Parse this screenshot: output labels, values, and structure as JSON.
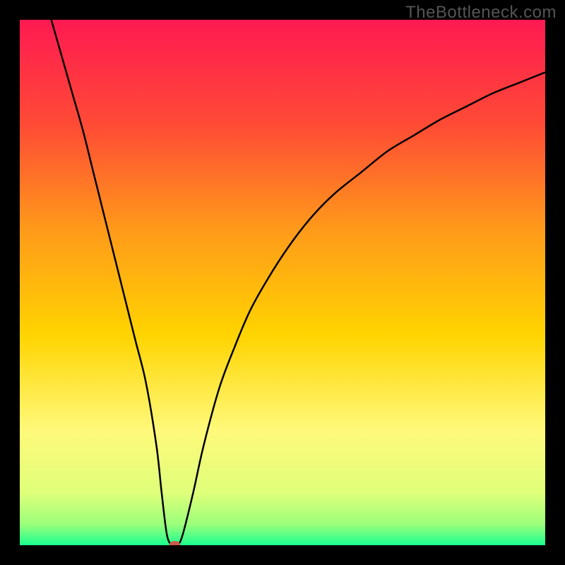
{
  "watermark": "TheBottleneck.com",
  "chart_data": {
    "type": "line",
    "title": "",
    "xlabel": "",
    "ylabel": "",
    "xlim": [
      0,
      100
    ],
    "ylim": [
      0,
      100
    ],
    "grid": false,
    "legend": false,
    "background_gradient": {
      "stops": [
        {
          "pos": 0.0,
          "color": "#ff1a52"
        },
        {
          "pos": 0.2,
          "color": "#ff4b35"
        },
        {
          "pos": 0.4,
          "color": "#ff9a1a"
        },
        {
          "pos": 0.6,
          "color": "#ffd400"
        },
        {
          "pos": 0.78,
          "color": "#fff97a"
        },
        {
          "pos": 0.9,
          "color": "#dfff7a"
        },
        {
          "pos": 0.96,
          "color": "#9cff7a"
        },
        {
          "pos": 1.0,
          "color": "#1aff90"
        }
      ]
    },
    "series": [
      {
        "name": "bottleneck-curve",
        "color": "#000000",
        "x": [
          6,
          8,
          10,
          12,
          14,
          16,
          18,
          20,
          22,
          24,
          26,
          27,
          28,
          29,
          30,
          31,
          33,
          35,
          38,
          41,
          44,
          48,
          52,
          56,
          60,
          65,
          70,
          75,
          80,
          85,
          90,
          95,
          100
        ],
        "y": [
          100,
          93,
          86,
          79,
          71,
          63,
          55,
          47,
          39,
          31,
          19,
          10,
          2,
          0,
          0,
          2,
          10,
          19,
          30,
          38,
          45,
          52,
          58,
          63,
          67,
          71,
          75,
          78,
          81,
          83.5,
          86,
          88,
          90
        ]
      }
    ],
    "marker": {
      "name": "optimal-point",
      "x": 29.5,
      "y": 0,
      "color": "#cc5a4a",
      "rx": 8,
      "ry": 6
    }
  }
}
